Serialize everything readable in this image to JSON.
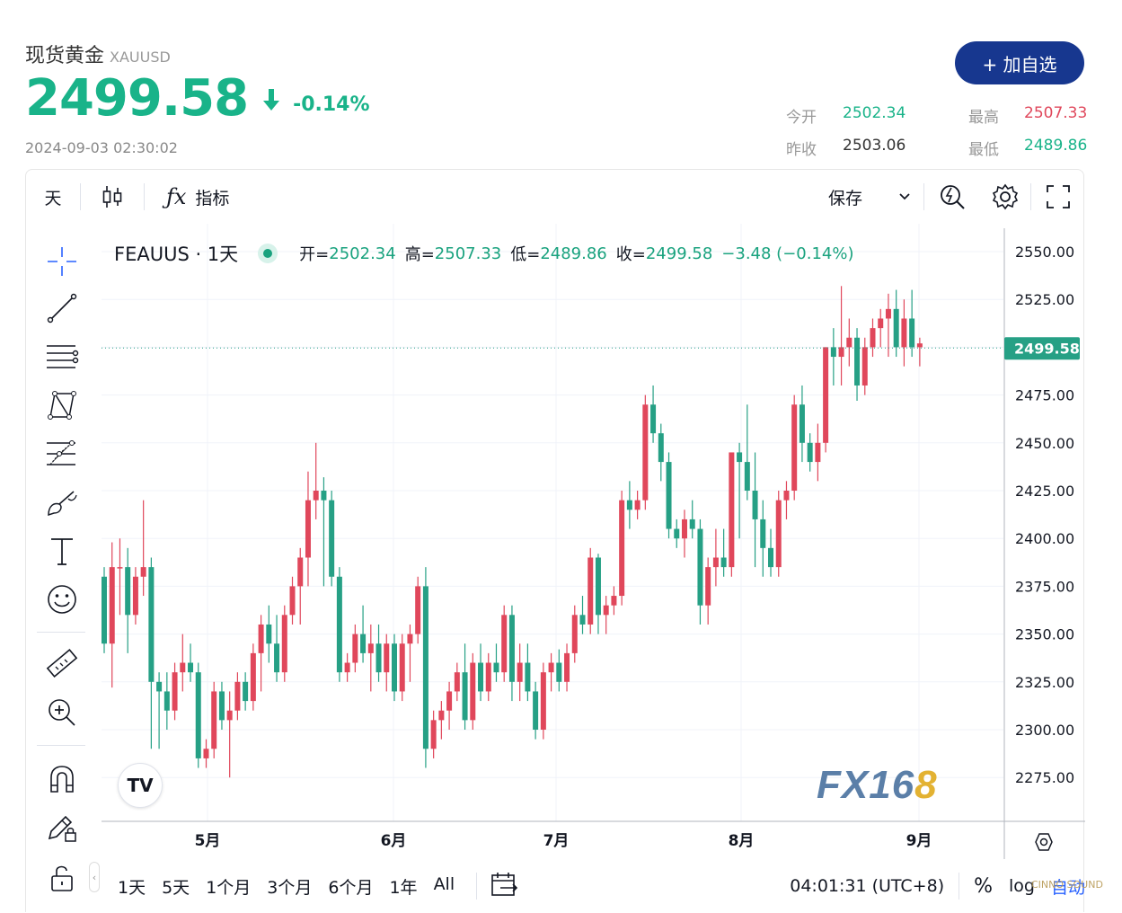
{
  "header": {
    "name": "现货黄金",
    "code": "XAUUSD",
    "price": "2499.58",
    "change_pct": "-0.14%",
    "timestamp": "2024-09-03 02:30:02",
    "add_button": "+ 加自选",
    "stats": {
      "open_label": "今开",
      "open": "2502.34",
      "high_label": "最高",
      "high": "2507.33",
      "prev_label": "昨收",
      "prev": "2503.06",
      "low_label": "最低",
      "low": "2489.86"
    }
  },
  "toolbar": {
    "interval": "天",
    "indicators": "指标",
    "save": "保存"
  },
  "legend": {
    "symbol": "FEAUUS · 1天",
    "open_label": "开=",
    "open": "2502.34",
    "high_label": "高=",
    "high": "2507.33",
    "low_label": "低=",
    "low": "2489.86",
    "close_label": "收=",
    "close": "2499.58",
    "change": "−3.48 (−0.14%)"
  },
  "bottom": {
    "ranges": [
      "1天",
      "5天",
      "1个月",
      "3个月",
      "6个月",
      "1年",
      "All"
    ],
    "clock": "04:01:31 (UTC+8)",
    "percent": "%",
    "log": "log",
    "auto": "自动"
  },
  "logos": {
    "tv": "TV",
    "fx_main": "FX16",
    "fx_tail": "8",
    "watermark": "CINNO SOUND"
  },
  "colors": {
    "up": "#e0475b",
    "down": "#26a085",
    "accent": "#17378f",
    "price_green": "#19b389"
  },
  "chart_data": {
    "type": "candlestick",
    "xticks": [
      "5月",
      "6月",
      "7月",
      "8月",
      "9月"
    ],
    "yticks": [
      "2550.00",
      "2525.00",
      "2475.00",
      "2450.00",
      "2425.00",
      "2400.00",
      "2375.00",
      "2350.00",
      "2325.00",
      "2300.00",
      "2275.00"
    ],
    "ylim": [
      2260,
      2560
    ],
    "last_price": 2499.58,
    "last_price_label": "2499.58",
    "candles": [
      [
        2380,
        2385,
        2340,
        2345
      ],
      [
        2345,
        2398,
        2322,
        2385
      ],
      [
        2385,
        2400,
        2360,
        2385
      ],
      [
        2385,
        2395,
        2340,
        2360
      ],
      [
        2360,
        2385,
        2355,
        2380
      ],
      [
        2380,
        2420,
        2370,
        2385
      ],
      [
        2385,
        2390,
        2290,
        2325
      ],
      [
        2325,
        2330,
        2290,
        2320
      ],
      [
        2320,
        2330,
        2300,
        2310
      ],
      [
        2310,
        2335,
        2305,
        2330
      ],
      [
        2330,
        2350,
        2320,
        2335
      ],
      [
        2335,
        2345,
        2325,
        2330
      ],
      [
        2330,
        2335,
        2280,
        2285
      ],
      [
        2285,
        2295,
        2280,
        2290
      ],
      [
        2290,
        2325,
        2285,
        2320
      ],
      [
        2320,
        2325,
        2300,
        2305
      ],
      [
        2305,
        2320,
        2275,
        2310
      ],
      [
        2310,
        2330,
        2305,
        2325
      ],
      [
        2325,
        2330,
        2310,
        2315
      ],
      [
        2315,
        2345,
        2310,
        2340
      ],
      [
        2340,
        2360,
        2320,
        2355
      ],
      [
        2355,
        2365,
        2335,
        2345
      ],
      [
        2345,
        2360,
        2325,
        2330
      ],
      [
        2330,
        2365,
        2325,
        2360
      ],
      [
        2360,
        2380,
        2355,
        2375
      ],
      [
        2375,
        2395,
        2355,
        2390
      ],
      [
        2390,
        2435,
        2375,
        2420
      ],
      [
        2420,
        2450,
        2410,
        2425
      ],
      [
        2425,
        2432,
        2375,
        2420
      ],
      [
        2420,
        2425,
        2375,
        2380
      ],
      [
        2380,
        2385,
        2325,
        2330
      ],
      [
        2330,
        2340,
        2325,
        2335
      ],
      [
        2335,
        2355,
        2330,
        2350
      ],
      [
        2350,
        2365,
        2335,
        2340
      ],
      [
        2340,
        2355,
        2320,
        2345
      ],
      [
        2345,
        2355,
        2325,
        2330
      ],
      [
        2330,
        2350,
        2320,
        2345
      ],
      [
        2345,
        2350,
        2315,
        2320
      ],
      [
        2320,
        2350,
        2315,
        2345
      ],
      [
        2345,
        2355,
        2325,
        2350
      ],
      [
        2350,
        2380,
        2345,
        2375
      ],
      [
        2375,
        2385,
        2280,
        2290
      ],
      [
        2290,
        2310,
        2285,
        2305
      ],
      [
        2305,
        2315,
        2295,
        2310
      ],
      [
        2310,
        2325,
        2300,
        2320
      ],
      [
        2320,
        2335,
        2315,
        2330
      ],
      [
        2330,
        2345,
        2300,
        2305
      ],
      [
        2305,
        2340,
        2300,
        2335
      ],
      [
        2335,
        2345,
        2315,
        2320
      ],
      [
        2320,
        2340,
        2315,
        2335
      ],
      [
        2335,
        2345,
        2325,
        2330
      ],
      [
        2330,
        2365,
        2325,
        2360
      ],
      [
        2360,
        2365,
        2315,
        2325
      ],
      [
        2325,
        2345,
        2315,
        2335
      ],
      [
        2335,
        2345,
        2315,
        2320
      ],
      [
        2320,
        2325,
        2295,
        2300
      ],
      [
        2300,
        2335,
        2295,
        2330
      ],
      [
        2330,
        2340,
        2320,
        2335
      ],
      [
        2335,
        2342,
        2320,
        2325
      ],
      [
        2325,
        2345,
        2320,
        2340
      ],
      [
        2340,
        2365,
        2335,
        2360
      ],
      [
        2360,
        2370,
        2350,
        2355
      ],
      [
        2355,
        2395,
        2350,
        2390
      ],
      [
        2390,
        2392,
        2350,
        2360
      ],
      [
        2360,
        2370,
        2350,
        2365
      ],
      [
        2365,
        2375,
        2360,
        2370
      ],
      [
        2370,
        2425,
        2365,
        2420
      ],
      [
        2420,
        2430,
        2405,
        2415
      ],
      [
        2415,
        2425,
        2410,
        2420
      ],
      [
        2420,
        2475,
        2415,
        2470
      ],
      [
        2470,
        2480,
        2450,
        2455
      ],
      [
        2455,
        2460,
        2430,
        2440
      ],
      [
        2440,
        2445,
        2400,
        2405
      ],
      [
        2405,
        2410,
        2395,
        2400
      ],
      [
        2400,
        2415,
        2390,
        2410
      ],
      [
        2410,
        2420,
        2400,
        2405
      ],
      [
        2405,
        2410,
        2355,
        2365
      ],
      [
        2365,
        2390,
        2355,
        2385
      ],
      [
        2385,
        2405,
        2375,
        2390
      ],
      [
        2390,
        2405,
        2380,
        2385
      ],
      [
        2385,
        2445,
        2380,
        2445
      ],
      [
        2445,
        2450,
        2400,
        2440
      ],
      [
        2440,
        2470,
        2420,
        2425
      ],
      [
        2425,
        2445,
        2385,
        2410
      ],
      [
        2410,
        2420,
        2380,
        2395
      ],
      [
        2395,
        2405,
        2380,
        2385
      ],
      [
        2385,
        2425,
        2380,
        2420
      ],
      [
        2420,
        2430,
        2410,
        2425
      ],
      [
        2425,
        2475,
        2420,
        2470
      ],
      [
        2470,
        2480,
        2440,
        2450
      ],
      [
        2450,
        2455,
        2435,
        2440
      ],
      [
        2440,
        2460,
        2430,
        2450
      ],
      [
        2450,
        2500,
        2445,
        2500
      ],
      [
        2500,
        2510,
        2480,
        2495
      ],
      [
        2495,
        2532,
        2480,
        2500
      ],
      [
        2500,
        2515,
        2490,
        2505
      ],
      [
        2505,
        2510,
        2472,
        2480
      ],
      [
        2480,
        2505,
        2475,
        2500
      ],
      [
        2500,
        2515,
        2495,
        2510
      ],
      [
        2510,
        2520,
        2500,
        2515
      ],
      [
        2515,
        2528,
        2495,
        2520
      ],
      [
        2520,
        2530,
        2495,
        2500
      ],
      [
        2500,
        2525,
        2490,
        2515
      ],
      [
        2515,
        2530,
        2495,
        2500
      ],
      [
        2500,
        2505,
        2490,
        2502
      ]
    ]
  }
}
